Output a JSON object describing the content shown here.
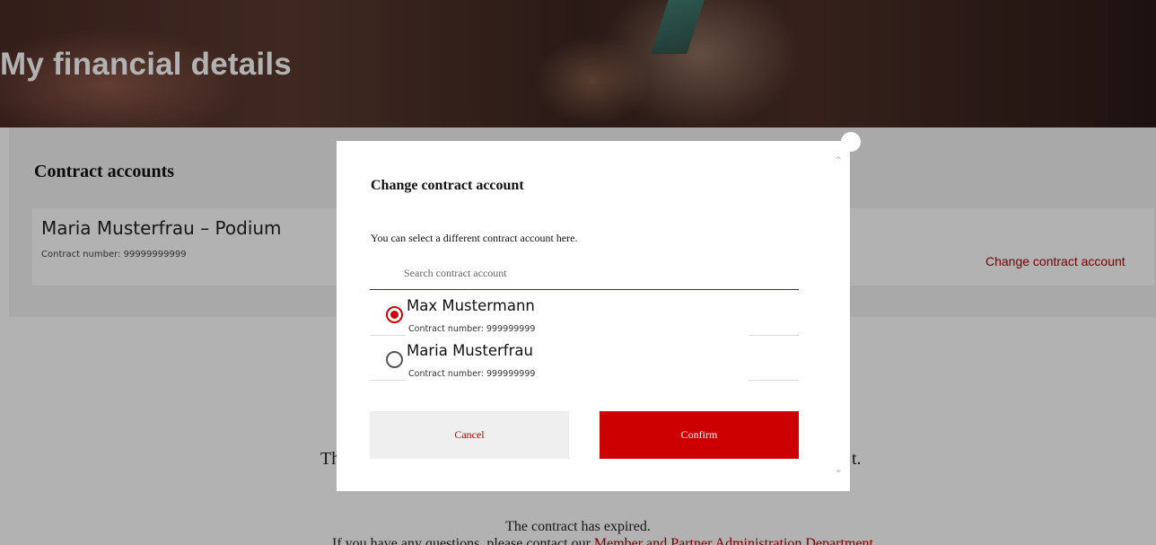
{
  "page": {
    "title": "My financial details"
  },
  "contracts": {
    "heading": "Contract accounts",
    "current_account": {
      "name": "Maria Musterfrau – Podium",
      "number": "Contract number: 99999999999"
    },
    "change_link": "Change contract account"
  },
  "messages": {
    "partial_left": "Th",
    "partial_right": "t.",
    "expired": "The contract has expired.",
    "bottom_prefix": "If you have any questions, please contact our ",
    "bottom_link": "Member and Partner Administration Department"
  },
  "modal": {
    "title": "Change contract account",
    "description": "You can select a different contract account here.",
    "search_placeholder": "Search contract account",
    "options": [
      {
        "name": "Max Mustermann",
        "number": "Contract number: 999999999",
        "selected": true
      },
      {
        "name": "Maria Musterfrau",
        "number": "Contract number: 999999999",
        "selected": false
      }
    ],
    "cancel_label": "Cancel",
    "confirm_label": "Confirm"
  },
  "icons": {
    "close": "close-icon",
    "scroll_up": "chevron-up-icon",
    "scroll_down": "chevron-down-icon"
  },
  "colors": {
    "accent": "#cc0000",
    "link": "#b00000",
    "overlay": "rgba(0,0,0,0.30)"
  }
}
